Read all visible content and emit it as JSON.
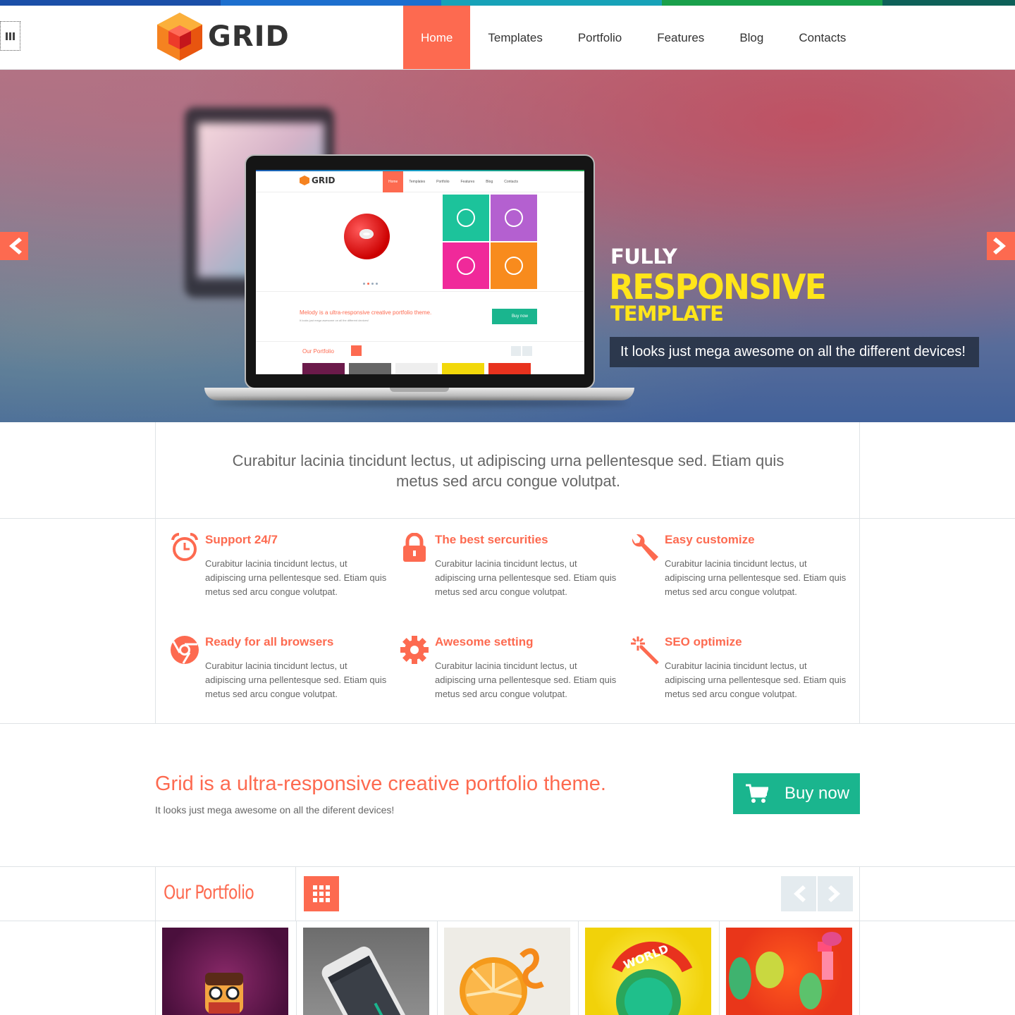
{
  "colors": {
    "accent": "#fd6a50",
    "green": "#1ab58e",
    "yellow": "#ffe51a",
    "strip": [
      "#1b4fa8",
      "#1d6fce",
      "#17a2b8",
      "#1aa04b",
      "#0d6058"
    ]
  },
  "header": {
    "menu_toggle_icon": "menu-bars-icon",
    "logo_text": "GRID",
    "nav": [
      {
        "label": "Home",
        "active": true
      },
      {
        "label": "Templates",
        "active": false
      },
      {
        "label": "Portfolio",
        "active": false
      },
      {
        "label": "Features",
        "active": false
      },
      {
        "label": "Blog",
        "active": false
      },
      {
        "label": "Contacts",
        "active": false
      }
    ]
  },
  "hero": {
    "line1": "FULLY",
    "line2": "RESPONSIVE",
    "line3": "TEMPLATE",
    "caption": "It looks just mega awesome on all the different devices!",
    "prev_icon": "arrow-left-icon",
    "next_icon": "arrow-right-icon",
    "mockup": {
      "logo_text": "GRID",
      "nav": [
        "Home",
        "Templates",
        "Portfolio",
        "Features",
        "Blog",
        "Contacts"
      ],
      "tagline": "Melody is a ultra-responsive creative portfolio theme.",
      "sub": "It looks just mega awesome on all the different devices!",
      "buy_label": "Buy now",
      "portfolio_label": "Our Portfolio"
    }
  },
  "intro": {
    "text": "Curabitur lacinia tincidunt lectus, ut adipiscing urna pellentesque sed. Etiam quis metus sed arcu congue volutpat."
  },
  "features": [
    {
      "icon": "alarm-clock-icon",
      "title": "Support 24/7",
      "text": "Curabitur lacinia tincidunt lectus, ut adipiscing urna pellentesque sed. Etiam quis metus sed arcu congue volutpat."
    },
    {
      "icon": "lock-icon",
      "title": "The best sercurities",
      "text": "Curabitur lacinia tincidunt lectus, ut adipiscing urna pellentesque sed. Etiam quis metus sed arcu congue volutpat."
    },
    {
      "icon": "wrench-icon",
      "title": "Easy customize",
      "text": "Curabitur lacinia tincidunt lectus, ut adipiscing urna pellentesque sed. Etiam quis metus sed arcu congue volutpat."
    },
    {
      "icon": "chrome-icon",
      "title": "Ready for all browsers",
      "text": "Curabitur lacinia tincidunt lectus, ut adipiscing urna pellentesque sed. Etiam quis metus sed arcu congue volutpat."
    },
    {
      "icon": "gear-icon",
      "title": "Awesome setting",
      "text": "Curabitur lacinia tincidunt lectus, ut adipiscing urna pellentesque sed. Etiam quis metus sed arcu congue volutpat."
    },
    {
      "icon": "magic-wand-icon",
      "title": "SEO optimize",
      "text": "Curabitur lacinia tincidunt lectus, ut adipiscing urna pellentesque sed. Etiam quis metus sed arcu congue volutpat."
    }
  ],
  "cta": {
    "title": "Grid is a ultra-responsive creative portfolio theme.",
    "sub": "It looks just mega awesome on all the diferent devices!",
    "button_label": "Buy now",
    "button_icon": "cart-icon"
  },
  "portfolio": {
    "title": "Our Portfolio",
    "grid_icon": "grid-icon",
    "prev_icon": "chevron-left-icon",
    "next_icon": "chevron-right-icon",
    "items": [
      {
        "name": "portfolio-item-pixel-character"
      },
      {
        "name": "portfolio-item-phone-app"
      },
      {
        "name": "portfolio-item-orange"
      },
      {
        "name": "portfolio-item-world-wide"
      },
      {
        "name": "portfolio-item-3d-characters"
      }
    ]
  }
}
